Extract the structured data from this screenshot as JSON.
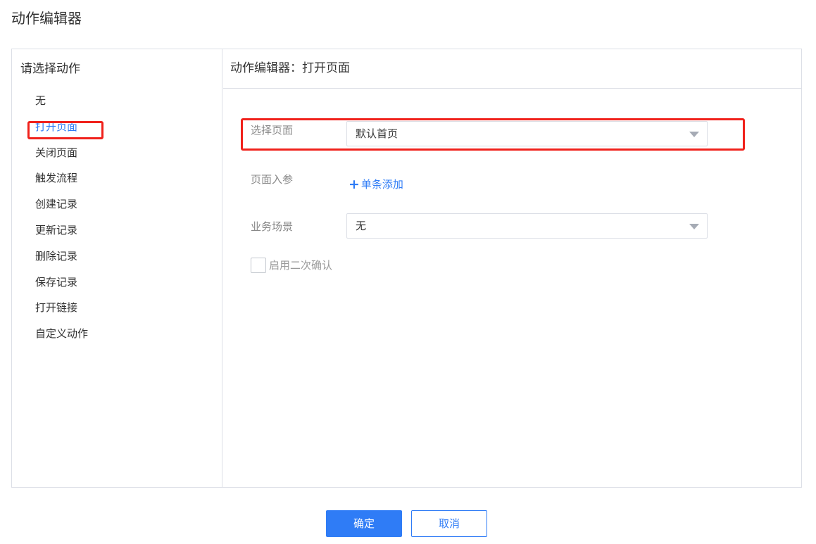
{
  "dialog": {
    "title": "动作编辑器"
  },
  "left_panel": {
    "header": "请选择动作",
    "actions": [
      {
        "label": "无"
      },
      {
        "label": "打开页面",
        "selected": true
      },
      {
        "label": "关闭页面"
      },
      {
        "label": "触发流程"
      },
      {
        "label": "创建记录"
      },
      {
        "label": "更新记录"
      },
      {
        "label": "删除记录"
      },
      {
        "label": "保存记录"
      },
      {
        "label": "打开链接"
      },
      {
        "label": "自定义动作"
      }
    ]
  },
  "right_panel": {
    "header": "动作编辑器：打开页面",
    "select_page": {
      "label": "选择页面",
      "value": "默认首页"
    },
    "page_params": {
      "label": "页面入参",
      "add_label": "单条添加"
    },
    "business_scene": {
      "label": "业务场景",
      "value": "无"
    },
    "second_confirm": {
      "label": "启用二次确认",
      "checked": false
    }
  },
  "footer": {
    "confirm_label": "确定",
    "cancel_label": "取消"
  },
  "colors": {
    "accent": "#2f7cf6",
    "highlight": "#f0211b",
    "border": "#dcdfe6"
  },
  "icons": {
    "add": "plus-icon",
    "dropdown": "chevron-down-icon"
  }
}
